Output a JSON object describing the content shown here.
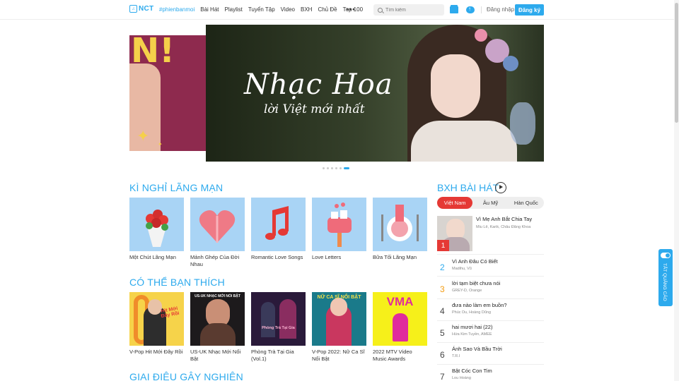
{
  "header": {
    "logo_text": "NCT",
    "logo_glyph": "♫",
    "nav": [
      "#phienbanmoi",
      "Bài Hát",
      "Playlist",
      "Tuyển Tập",
      "Video",
      "BXH",
      "Chủ Đề",
      "Top 100"
    ],
    "more": "•••",
    "search_placeholder": "Tìm kiếm",
    "login": "Đăng nhập",
    "signup": "Đăng ký"
  },
  "banner": {
    "side_letter": "N!",
    "title": "Nhạc Hoa",
    "subtitle": "lời Việt mới nhất",
    "dots": 6,
    "active_dot": 5
  },
  "section1": {
    "title": "KÌ NGHỈ LÃNG MẠN",
    "cards": [
      {
        "caption": "Một Chút Lãng Mạn",
        "icon": "bouquet-icon"
      },
      {
        "caption": "Mảnh Ghép Của Đời Nhau",
        "icon": "puzzle-heart-icon"
      },
      {
        "caption": "Romantic Love Songs",
        "icon": "music-note-icon"
      },
      {
        "caption": "Love Letters",
        "icon": "mailbox-icon"
      },
      {
        "caption": "Bữa Tối Lãng Mạn",
        "icon": "dinner-icon"
      }
    ]
  },
  "section2": {
    "title": "CÓ THỂ BẠN THÍCH",
    "cards": [
      {
        "caption": "V-Pop Hit Mới Đây Rồi",
        "thumb_text": "Hit Mới Đây Rồi"
      },
      {
        "caption": "US-UK Nhạc Mới Nổi Bật",
        "thumb_text": "US-UK NHẠC MỚI NỔI BẬT"
      },
      {
        "caption": "Phòng Trà Tại Gia (Vol.1)",
        "thumb_text": "Phòng Trà Tại Gia"
      },
      {
        "caption": "V-Pop 2022: Nữ Ca Sĩ Nổi Bật",
        "thumb_text": "NỮ CA SĨ NỔI BẬT"
      },
      {
        "caption": "2022 MTV Video Music Awards",
        "thumb_text": "VMA"
      }
    ]
  },
  "section3": {
    "title": "GIAI ĐIỆU GÂY NGHIỆN"
  },
  "chart": {
    "title": "BXH BÀI HÁT",
    "tabs": [
      "Việt Nam",
      "Âu Mỹ",
      "Hàn Quốc"
    ],
    "active_tab": 0,
    "rows": [
      {
        "rank": "1",
        "title": "Vì Mẹ Anh Bắt Chia Tay",
        "artist": "Miu Lê, Karik, Châu Đăng Khoa",
        "color": "#e53935"
      },
      {
        "rank": "2",
        "title": "Vì Anh Đâu Có Biết",
        "artist": "Madihu, Vũ",
        "color": "#2daaed"
      },
      {
        "rank": "3",
        "title": "lời tạm biệt chưa nói",
        "artist": "GREY-D, Orange",
        "color": "#f39c12"
      },
      {
        "rank": "4",
        "title": "đưa nào làm em buồn?",
        "artist": "Phúc Du, Hoàng Dũng",
        "color": "#444"
      },
      {
        "rank": "5",
        "title": "hai mươi hai (22)",
        "artist": "Hứa Kim Tuyền, AMEE",
        "color": "#444"
      },
      {
        "rank": "6",
        "title": "Ánh Sao Và Bầu Trời",
        "artist": "T.R.I",
        "color": "#444"
      },
      {
        "rank": "7",
        "title": "Bật Cóc Con Tim",
        "artist": "Lou Hoàng",
        "color": "#444"
      }
    ]
  },
  "ad_toggle": {
    "label": "TẮT QUẢNG CÁO"
  },
  "colors": {
    "accent": "#2daaed",
    "rank1": "#e53935"
  }
}
